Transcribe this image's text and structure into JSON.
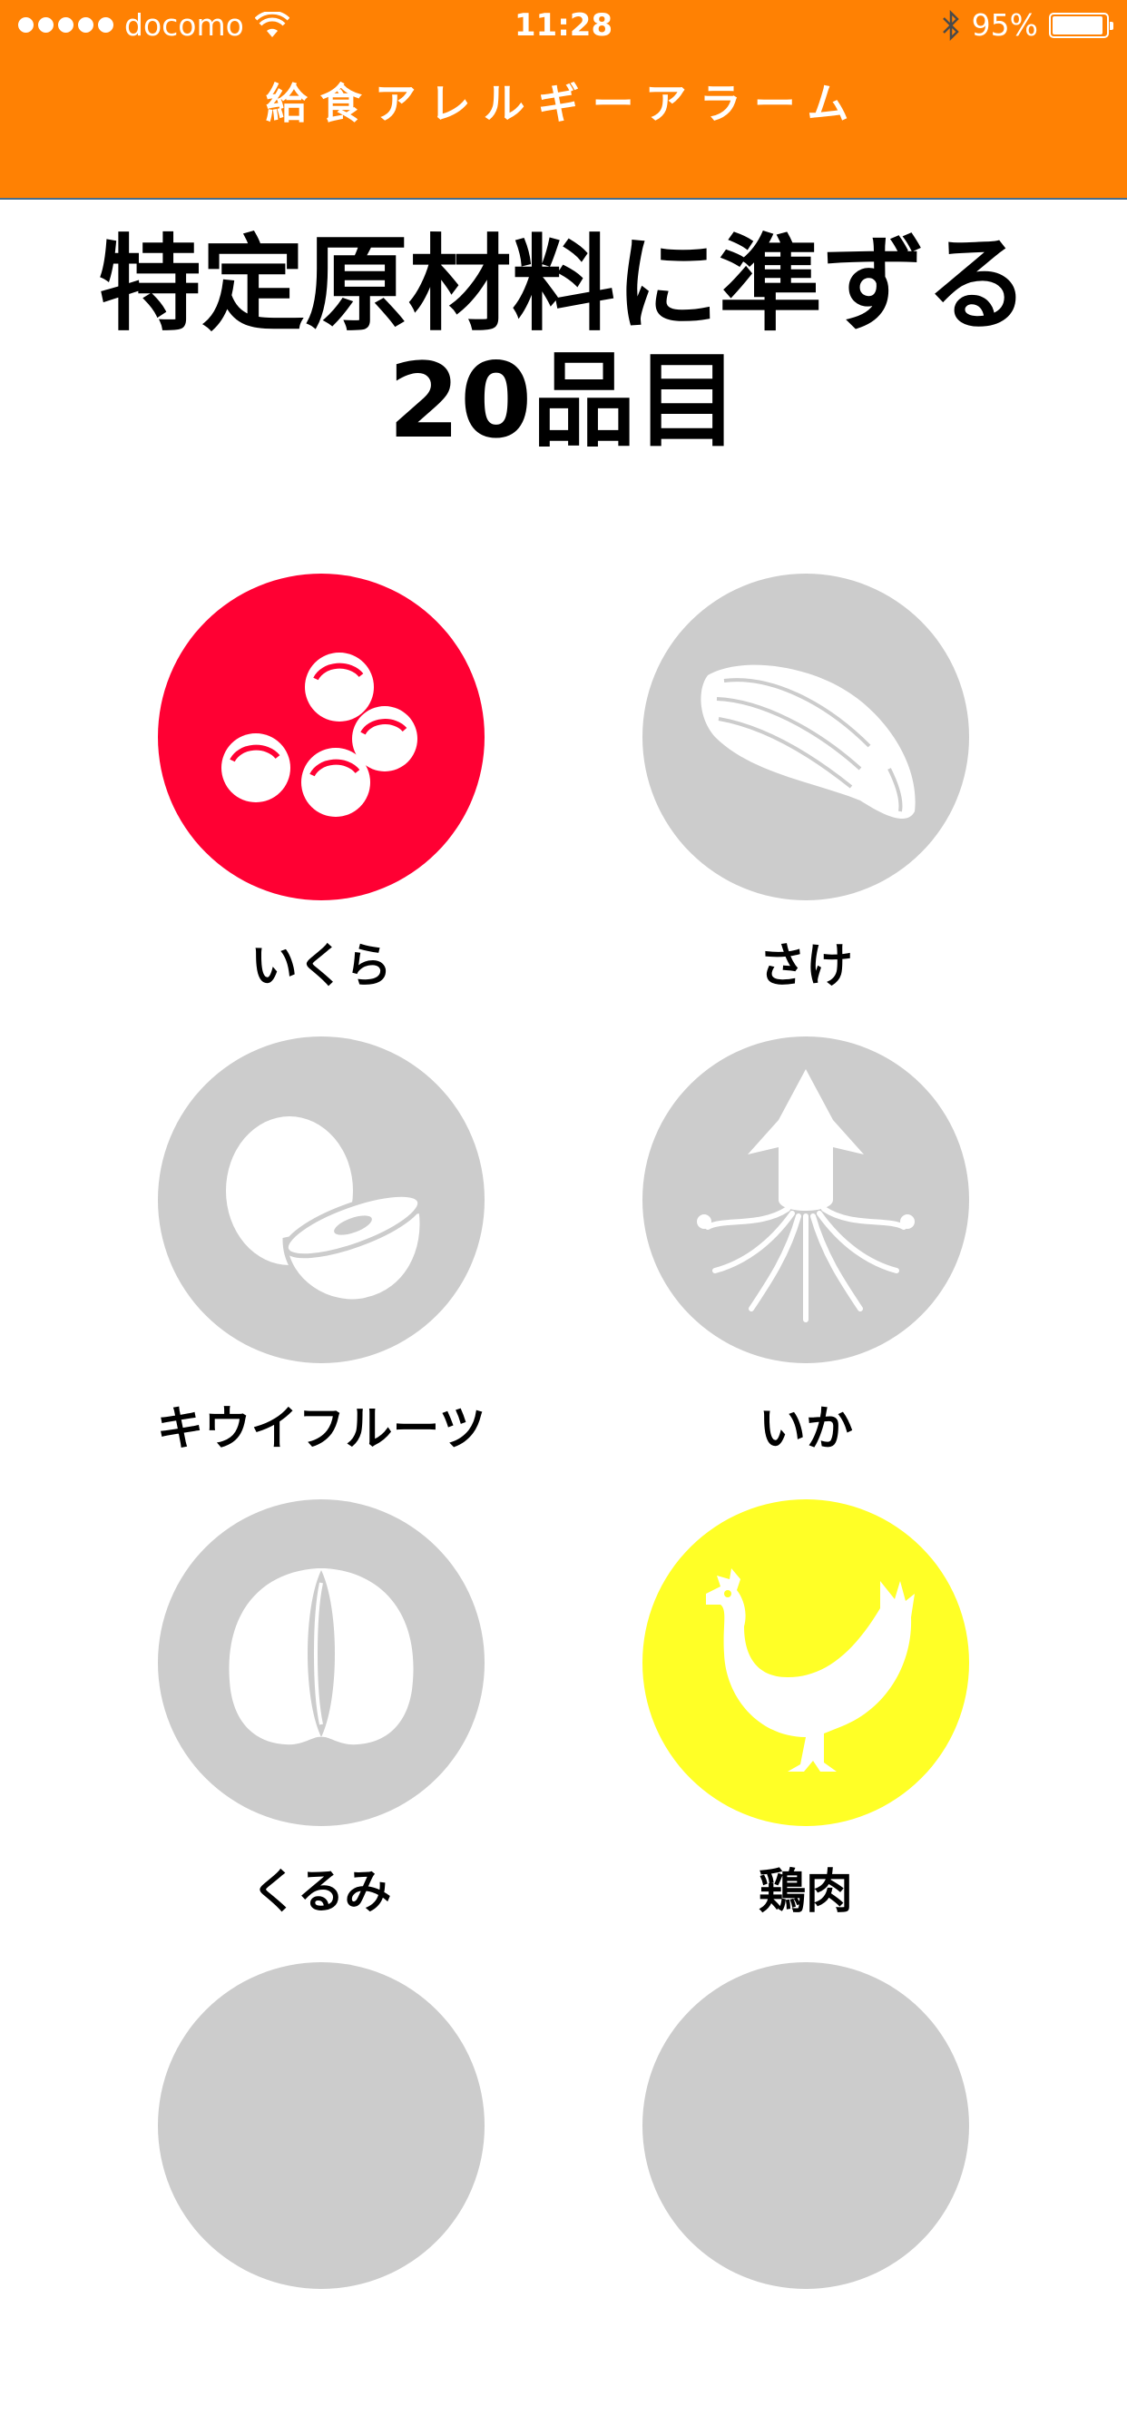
{
  "status_bar": {
    "carrier": "docomo",
    "time": "11:28",
    "battery_percent": "95%",
    "battery_level": 0.95,
    "signal_bars": 5,
    "icons": [
      "signal-dots-icon",
      "wifi-icon",
      "bluetooth-icon",
      "battery-icon"
    ]
  },
  "app_title": "給食アレルギーアラーム",
  "heading": {
    "line1": "特定原材料に準ずる",
    "line2": "20品目"
  },
  "colors": {
    "header_bg": "#ff8103",
    "inactive": "#cccccc",
    "ikura_active": "#ff0033",
    "chicken_active": "#ffff26"
  },
  "allergens": [
    {
      "label": "いくら",
      "icon": "salmon-roe-icon",
      "selected": true,
      "color": "#ff0033"
    },
    {
      "label": "さけ",
      "icon": "salmon-fillet-icon",
      "selected": false,
      "color": "#cccccc"
    },
    {
      "label": "キウイフルーツ",
      "icon": "kiwi-fruit-icon",
      "selected": false,
      "color": "#cccccc"
    },
    {
      "label": "いか",
      "icon": "squid-icon",
      "selected": false,
      "color": "#cccccc"
    },
    {
      "label": "くるみ",
      "icon": "walnut-icon",
      "selected": false,
      "color": "#cccccc"
    },
    {
      "label": "鶏肉",
      "icon": "chicken-icon",
      "selected": true,
      "color": "#ffff26"
    }
  ]
}
